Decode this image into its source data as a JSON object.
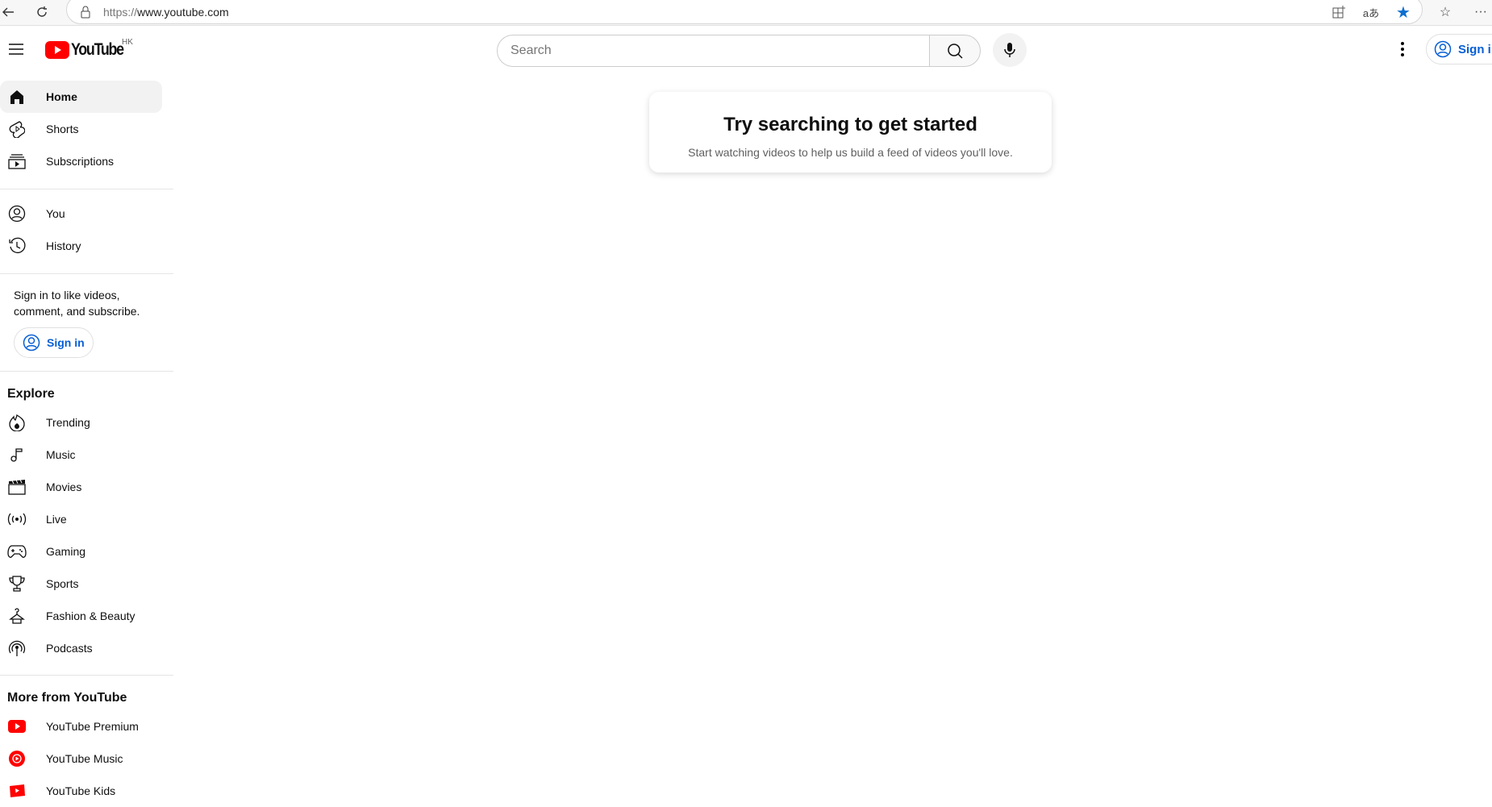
{
  "browser": {
    "url_scheme": "https://",
    "url_host": "www.youtube.com"
  },
  "header": {
    "logo_text": "YouTube",
    "region": "HK",
    "search_placeholder": "Search",
    "sign_in": "Sign in"
  },
  "sidebar": {
    "main": [
      {
        "label": "Home",
        "icon": "home-icon",
        "active": true
      },
      {
        "label": "Shorts",
        "icon": "shorts-icon"
      },
      {
        "label": "Subscriptions",
        "icon": "subscriptions-icon"
      }
    ],
    "you": [
      {
        "label": "You",
        "icon": "user-icon"
      },
      {
        "label": "History",
        "icon": "history-icon"
      }
    ],
    "signin_prompt_1": "Sign in to like videos,",
    "signin_prompt_2": "comment, and subscribe.",
    "signin_button": "Sign in",
    "explore_title": "Explore",
    "explore": [
      {
        "label": "Trending"
      },
      {
        "label": "Music"
      },
      {
        "label": "Movies"
      },
      {
        "label": "Live"
      },
      {
        "label": "Gaming"
      },
      {
        "label": "Sports"
      },
      {
        "label": "Fashion & Beauty"
      },
      {
        "label": "Podcasts"
      }
    ],
    "more_title": "More from YouTube",
    "more": [
      {
        "label": "YouTube Premium"
      },
      {
        "label": "YouTube Music"
      },
      {
        "label": "YouTube Kids"
      }
    ]
  },
  "main": {
    "title": "Try searching to get started",
    "subtitle": "Start watching videos to help us build a feed of videos you'll love."
  },
  "colors": {
    "brand_red": "#ff0000",
    "link_blue": "#065fd4",
    "favorite_star": "#0c6fd0"
  }
}
